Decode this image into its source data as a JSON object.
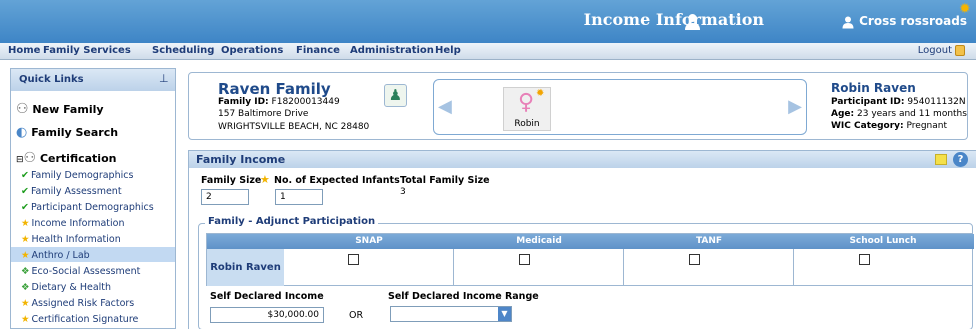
{
  "header": {
    "page_title": "Income Information",
    "user": "Cross rossroads"
  },
  "menu": {
    "items": [
      "Home",
      "Family Services",
      "Scheduling",
      "Operations",
      "Finance",
      "Administration",
      "Help"
    ],
    "logout": "Logout"
  },
  "sidebar": {
    "title": "Quick Links",
    "new_family": "New Family",
    "family_search": "Family Search",
    "certification": "Certification",
    "items": [
      {
        "label": "Family Demographics",
        "status": "check"
      },
      {
        "label": "Family Assessment",
        "status": "check"
      },
      {
        "label": "Participant Demographics",
        "status": "check"
      },
      {
        "label": "Income Information",
        "status": "star",
        "active": true
      },
      {
        "label": "Health Information",
        "status": "star"
      },
      {
        "label": "Anthro / Lab",
        "status": "star"
      },
      {
        "label": "Eco-Social Assessment",
        "status": "diamond"
      },
      {
        "label": "Dietary & Health",
        "status": "diamond"
      },
      {
        "label": "Assigned Risk Factors",
        "status": "star"
      },
      {
        "label": "Certification Signature",
        "status": "star"
      }
    ]
  },
  "family": {
    "name": "Raven Family",
    "id_label": "Family ID:",
    "id": "F18200013449",
    "address1": "157 Baltimore Drive",
    "address2": "WRIGHTSVILLE BEACH,   NC  28480"
  },
  "carousel": {
    "person": "Robin"
  },
  "participant": {
    "name": "Robin Raven",
    "id_label": "Participant ID:",
    "id": "954011132N",
    "age_label": "Age:",
    "age": "23 years and 11 months",
    "wic_label": "WIC Category:",
    "wic": "Pregnant"
  },
  "income": {
    "title": "Family Income",
    "family_size_label": "Family Size",
    "family_size": "2",
    "infants_label": "No. of Expected Infants",
    "infants": "1",
    "total_label": "Total Family Size",
    "total": "3",
    "adjunct_title": "Family - Adjunct Participation",
    "columns": [
      "SNAP",
      "Medicaid",
      "TANF",
      "School Lunch"
    ],
    "row_label": "Robin Raven",
    "self_income_label": "Self Declared Income",
    "self_income": "$30,000.00",
    "or": "OR",
    "range_label": "Self Declared Income Range"
  }
}
